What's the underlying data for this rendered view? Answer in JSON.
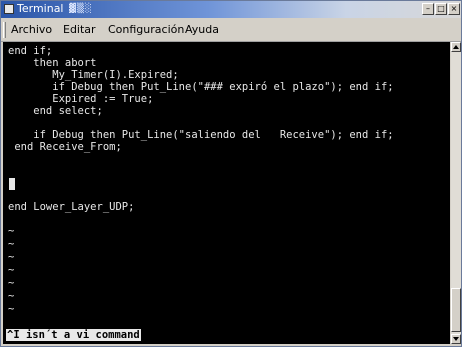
{
  "window": {
    "title": "Terminal",
    "title_decoration": "▓▒░",
    "buttons": {
      "minimize": "–",
      "maximize": "□",
      "close": "×"
    }
  },
  "menu": {
    "items": [
      "Archivo",
      "Editar",
      "Configuración",
      "Ayuda"
    ]
  },
  "terminal": {
    "lines": [
      "end if;",
      "    then abort",
      "       My_Timer(I).Expired;",
      "       if Debug then Put_Line(\"### expiró el plazo\"); end if;",
      "       Expired := True;",
      "    end select;",
      "",
      "    if Debug then Put_Line(\"saliendo del   Receive\"); end if;",
      " end Receive_From;",
      "",
      "",
      "",
      "end Lower_Layer_UDP;",
      "",
      "~",
      "~",
      "~",
      "~",
      "~",
      "~",
      "~"
    ],
    "status_message": "^I isn´t a vi command"
  },
  "colors": {
    "terminal_bg": "#000000",
    "terminal_fg": "#e8e8e8",
    "titlebar_start": "#2a55a8",
    "window_chrome": "#d4d0c8"
  }
}
